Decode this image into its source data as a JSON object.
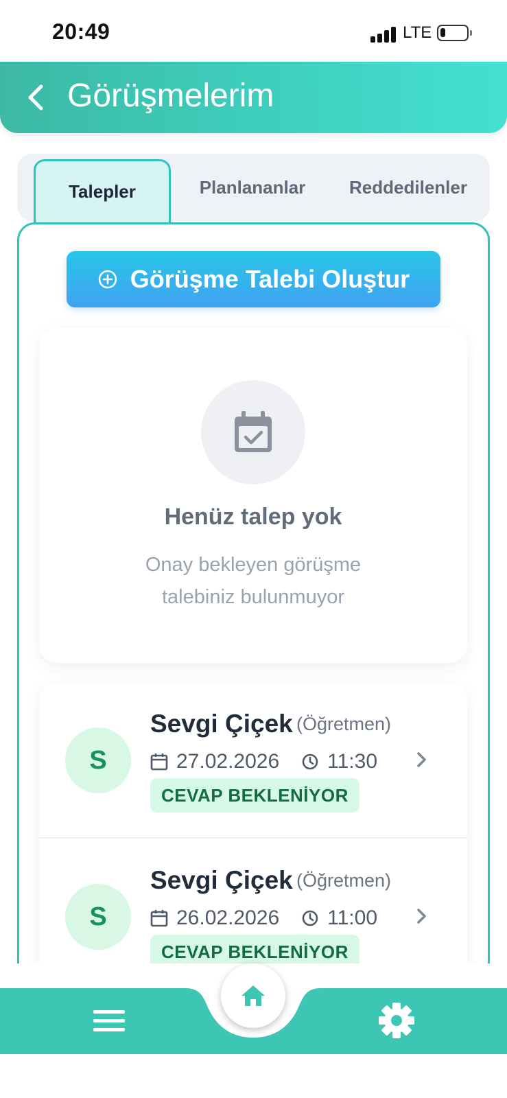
{
  "status_bar": {
    "time": "20:49",
    "network": "LTE",
    "battery_percent": 20
  },
  "header": {
    "back_icon": "chevron-left-icon",
    "title": "Görüşmelerim"
  },
  "tabs": [
    {
      "label": "Talepler",
      "active": true
    },
    {
      "label": "Planlananlar",
      "active": false
    },
    {
      "label": "Reddedilenler",
      "active": false
    }
  ],
  "create_button": {
    "icon": "plus-circle-icon",
    "label": "Görüşme Talebi Oluştur"
  },
  "empty_state": {
    "icon": "calendar-check-icon",
    "title": "Henüz talep yok",
    "description": "Onay bekleyen görüşme talebiniz bulunmuyor"
  },
  "requests": [
    {
      "avatar_initial": "S",
      "name": "Sevgi Çiçek",
      "role": "(Öğretmen)",
      "date": "27.02.2026",
      "time": "11:30",
      "status": "CEVAP BEKLENİYOR"
    },
    {
      "avatar_initial": "S",
      "name": "Sevgi Çiçek",
      "role": "(Öğretmen)",
      "date": "26.02.2026",
      "time": "11:00",
      "status": "CEVAP BEKLENİYOR"
    }
  ],
  "bottom_nav": {
    "left_icon": "menu-icon",
    "center_icon": "home-icon",
    "right_icon": "gear-icon"
  },
  "colors": {
    "accent_teal": "#3ec6b4",
    "button_blue": "#3fa3f2",
    "status_green_bg": "#d6f8e6",
    "status_green_text": "#136b43"
  }
}
